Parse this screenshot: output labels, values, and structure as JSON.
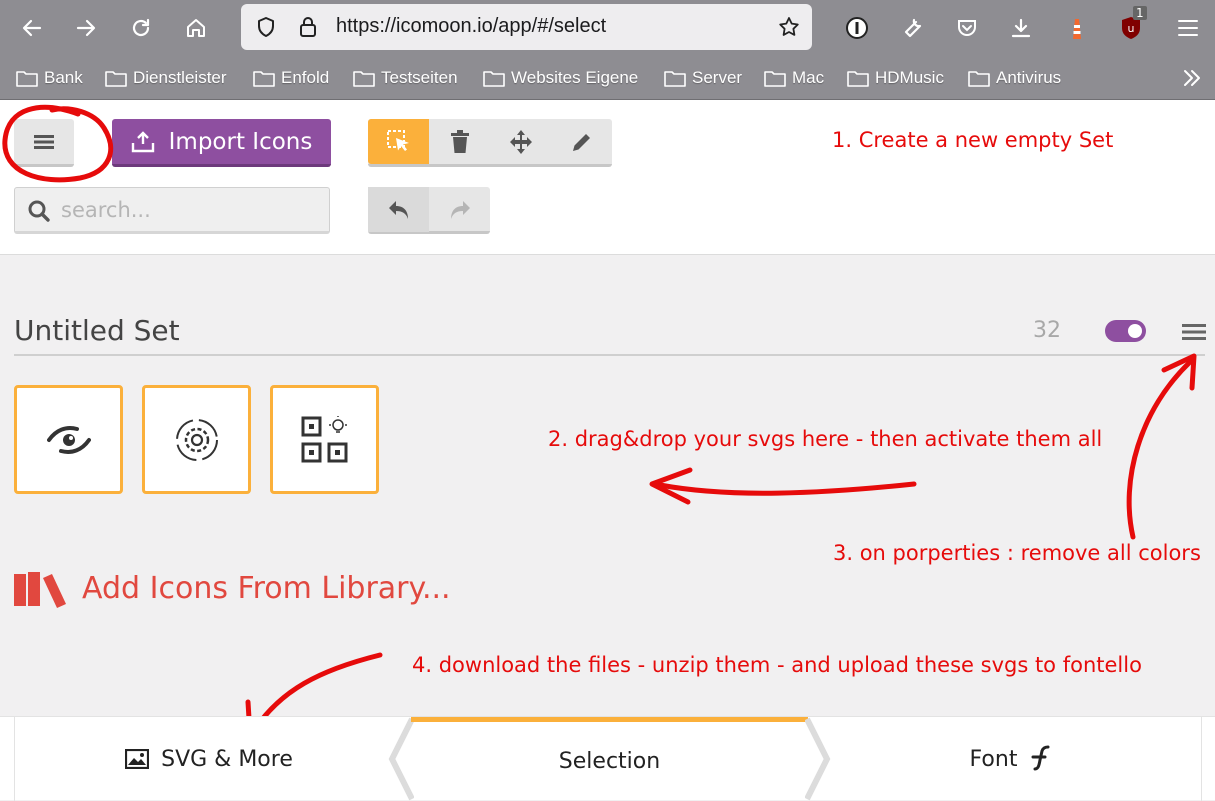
{
  "browser": {
    "url": "https://icomoon.io/app/#/select",
    "badge_count": "1",
    "bookmarks": [
      "Bank",
      "Dienstleister",
      "Enfold",
      "Testseiten",
      "Websites Eigene",
      "Server",
      "Mac",
      "HDMusic",
      "Antivirus"
    ]
  },
  "header": {
    "import_label": "Import Icons",
    "search_placeholder": "search..."
  },
  "set": {
    "title": "Untitled Set",
    "count": "32",
    "enabled": true,
    "glyphs": [
      "eye-swirl-icon",
      "gear-cycle-icon",
      "qr-code-bulb-icon"
    ]
  },
  "library": {
    "label": "Add Icons From Library..."
  },
  "annotations": {
    "step1": "1. Create a new empty Set",
    "step2": "2. drag&drop your svgs here - then activate them all",
    "step3": "3. on porperties : remove all colors",
    "step4": "4. download the files - unzip them - and upload these svgs to fontello"
  },
  "bottom_tabs": {
    "svg": "SVG & More",
    "selection": "Selection",
    "font": "Font"
  },
  "colors": {
    "accent": "#fbb03b",
    "purple": "#8e4fa0",
    "annotation_red": "#e60b0b",
    "library_red": "#e1483f"
  }
}
